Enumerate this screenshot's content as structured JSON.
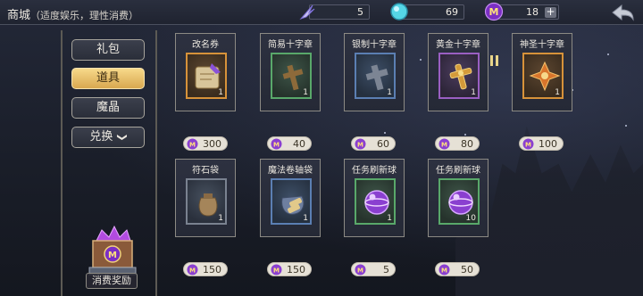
{
  "header": {
    "title": "商城",
    "subtitle": "（适度娱乐，理性消费）",
    "currencies": [
      {
        "icon": "feather-icon",
        "value": "5"
      },
      {
        "icon": "crystal-orb-icon",
        "value": "69"
      },
      {
        "icon": "magic-gem-icon",
        "value": "18",
        "plus": "+"
      }
    ],
    "back_icon": "back-arrow-icon"
  },
  "sidebar": {
    "tabs": [
      {
        "label": "礼包",
        "active": false
      },
      {
        "label": "道具",
        "active": true
      },
      {
        "label": "魔晶",
        "active": false
      },
      {
        "label": "兑换",
        "active": false,
        "dropdown": "❯"
      }
    ],
    "reward_label": "消费奖励"
  },
  "items": [
    {
      "name": "改名券",
      "qty": "1",
      "price": "300",
      "rarity": "orange",
      "icon": "rename-scroll-icon"
    },
    {
      "name": "简易十字章",
      "qty": "1",
      "price": "40",
      "rarity": "green",
      "icon": "wooden-cross-icon"
    },
    {
      "name": "银制十字章",
      "qty": "1",
      "price": "60",
      "rarity": "blue",
      "icon": "silver-cross-icon"
    },
    {
      "name": "黄金十字章",
      "qty": "1",
      "price": "80",
      "rarity": "purple",
      "icon": "gold-cross-icon"
    },
    {
      "name": "神圣十字章",
      "qty": "1",
      "price": "100",
      "rarity": "orange",
      "icon": "holy-cross-icon"
    },
    {
      "name": "符石袋",
      "qty": "1",
      "price": "150",
      "rarity": "gray",
      "icon": "rune-bag-icon"
    },
    {
      "name": "魔法卷轴袋",
      "qty": "1",
      "price": "150",
      "rarity": "blue",
      "icon": "scroll-bag-icon"
    },
    {
      "name": "任务刷新球",
      "qty": "1",
      "price": "5",
      "rarity": "green",
      "icon": "refresh-orb-icon"
    },
    {
      "name": "任务刷新球",
      "qty": "10",
      "price": "50",
      "rarity": "green",
      "icon": "refresh-orb-icon"
    }
  ],
  "colors": {
    "active_tab": "#e8bd6a",
    "price_pill": "#e6e1d6",
    "gem": "#8a3fd0"
  }
}
